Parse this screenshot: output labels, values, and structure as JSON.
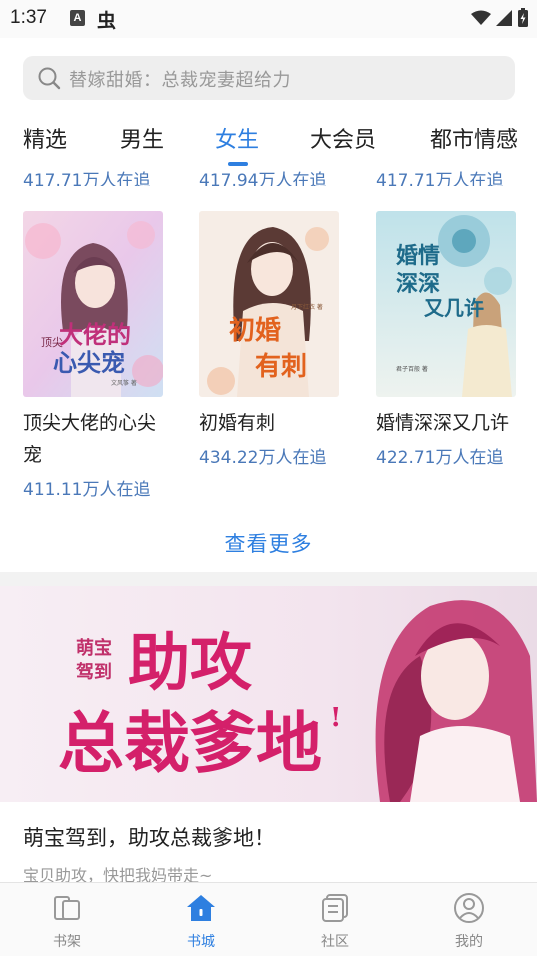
{
  "status_bar": {
    "time": "1:37",
    "badge_letter": "A",
    "bug_glyph": "虫"
  },
  "search": {
    "placeholder": "替嫁甜婚：总裁宠妻超给力",
    "icon": "search-icon"
  },
  "tabs": [
    {
      "label": "精选",
      "active": false
    },
    {
      "label": "男生",
      "active": false
    },
    {
      "label": "女生",
      "active": true
    },
    {
      "label": "大会员",
      "active": false
    },
    {
      "label": "都市情感",
      "active": false
    }
  ],
  "previous_row_readers": [
    "417.71万人在追",
    "417.94万人在追",
    "417.71万人在追"
  ],
  "books": [
    {
      "title": "顶尖大佬的心尖宠",
      "readers": "411.11万人在追",
      "cover_text_small": "顶尖",
      "cover_text_big": "大佬的",
      "cover_text_big2": "心尖宠",
      "cover_author": "文风筝 著"
    },
    {
      "title": "初婚有刺",
      "readers": "434.22万人在追",
      "cover_text_big": "初婚",
      "cover_text_big2": "有刺",
      "cover_author": "月下红衣 著"
    },
    {
      "title": "婚情深深又几许",
      "readers": "422.71万人在追",
      "cover_text_big": "婚情",
      "cover_text_big2": "深深",
      "cover_text_side": "又几许",
      "cover_author": "君子百般 著"
    }
  ],
  "more_label": "查看更多",
  "banner": {
    "art_small_1": "萌宝",
    "art_small_2": "驾到",
    "art_big_1": "助攻",
    "art_big_2": "总裁爹地",
    "art_mark": "!",
    "title": "萌宝驾到，助攻总裁爹地！",
    "subtitle": "宝贝助攻，快把我妈带走~"
  },
  "bottom_nav": [
    {
      "label": "书架",
      "icon": "bookshelf-icon",
      "active": false
    },
    {
      "label": "书城",
      "icon": "bookstore-home-icon",
      "active": true
    },
    {
      "label": "社区",
      "icon": "community-icon",
      "active": false
    },
    {
      "label": "我的",
      "icon": "profile-icon",
      "active": false
    }
  ],
  "colors": {
    "accent": "#2e7fe0",
    "readers_text": "#4a78b8",
    "placeholder_text": "#999999",
    "nav_inactive": "#888888"
  }
}
